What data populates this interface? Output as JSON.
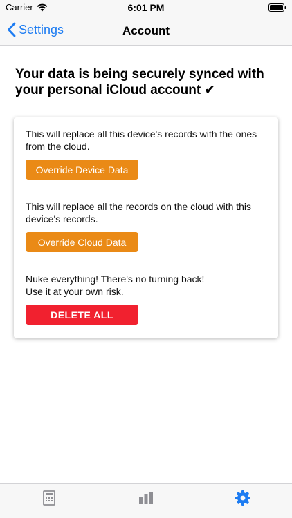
{
  "status_bar": {
    "carrier": "Carrier",
    "time": "6:01 PM"
  },
  "nav": {
    "back_label": "Settings",
    "title": "Account"
  },
  "headline": "Your data is being securely synced with your personal iCloud account ✔",
  "card": {
    "device_desc": "This will replace all this device's records with the ones from the cloud.",
    "device_button": "Override Device Data",
    "cloud_desc": "This will replace all the records on the cloud with this device's records.",
    "cloud_button": "Override Cloud Data",
    "nuke_desc_line1": "Nuke everything! There's no turning back!",
    "nuke_desc_line2": "Use it at your own risk.",
    "delete_button": "DELETE ALL"
  },
  "tabs": [
    {
      "icon": "calculator-icon",
      "selected": false
    },
    {
      "icon": "bar-chart-icon",
      "selected": false
    },
    {
      "icon": "gear-icon",
      "selected": true
    }
  ],
  "colors": {
    "accent": "#1d7cf2",
    "orange": "#ea8a16",
    "danger": "#f1212f",
    "tab_inactive": "#8e8e93"
  }
}
